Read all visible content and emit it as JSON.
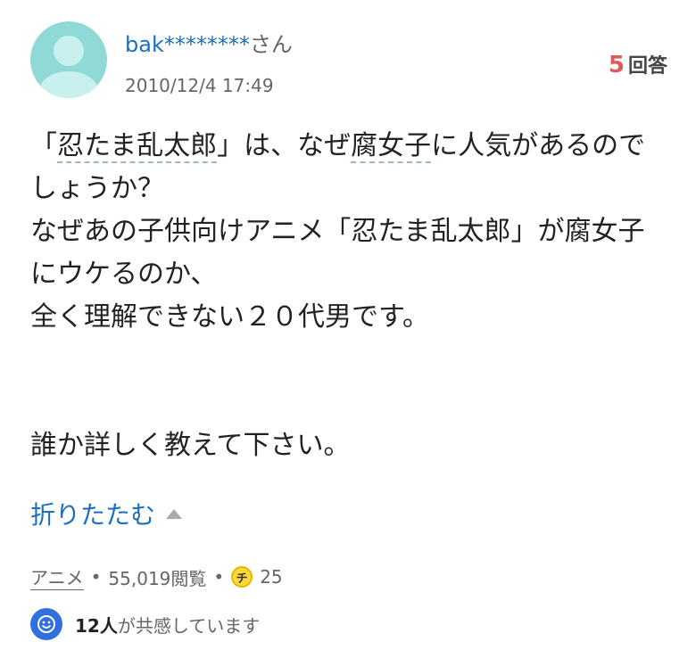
{
  "user": {
    "name": "bak********",
    "suffix": "さん",
    "date": "2010/12/4 17:49"
  },
  "answers": {
    "count": "5",
    "label": "回答"
  },
  "question": {
    "line1_kw1": "忍たま乱太郎",
    "line1_a": "「",
    "line1_b": "」は、なぜ",
    "line1_kw2": "腐女子",
    "line1_c": "に人気があるので",
    "line2": "しょうか？",
    "line3": "なぜあの子供向けアニメ「忍たま乱太郎」が腐女子",
    "line4": "にウケるのか、",
    "line5": "全く理解できない２０代男です。",
    "line6": "誰か詳しく教えて下さい。"
  },
  "fold_label": "折りたたむ",
  "meta": {
    "category": "アニメ",
    "views": "55,019閲覧",
    "coin_label": "チ",
    "coins": "25"
  },
  "empathy": {
    "count": "12人",
    "text": "が共感しています"
  }
}
